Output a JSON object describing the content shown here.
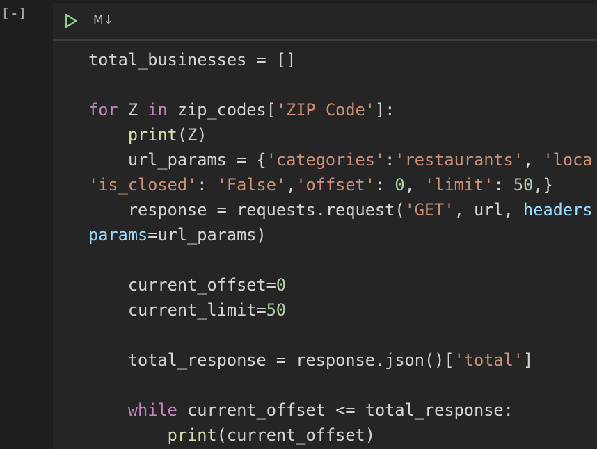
{
  "cell": {
    "execution_count": "[-]",
    "type_label": "M↓",
    "run_icon": "play-icon",
    "run_icon_color": "#89d185"
  },
  "colors": {
    "background": "#1e1e1e",
    "cell_background": "#252526",
    "plain": "#d4d4d4",
    "keyword": "#c586c0",
    "function": "#dcdcaa",
    "string": "#ce9178",
    "number": "#b5cea8",
    "parameter": "#9cdcfe"
  },
  "code": {
    "lines": [
      [
        {
          "t": "total_businesses = []",
          "c": "plain"
        }
      ],
      [],
      [
        {
          "t": "for",
          "c": "kw"
        },
        {
          "t": " Z ",
          "c": "plain"
        },
        {
          "t": "in",
          "c": "kw"
        },
        {
          "t": " zip_codes[",
          "c": "plain"
        },
        {
          "t": "'ZIP Code'",
          "c": "str"
        },
        {
          "t": "]:",
          "c": "plain"
        }
      ],
      [
        {
          "t": "    ",
          "c": "plain"
        },
        {
          "t": "print",
          "c": "fn"
        },
        {
          "t": "(Z)",
          "c": "plain"
        }
      ],
      [
        {
          "t": "    url_params = {",
          "c": "plain"
        },
        {
          "t": "'categories'",
          "c": "str"
        },
        {
          "t": ":",
          "c": "plain"
        },
        {
          "t": "'restaurants'",
          "c": "str"
        },
        {
          "t": ", ",
          "c": "plain"
        },
        {
          "t": "'loca",
          "c": "str"
        }
      ],
      [
        {
          "t": "'is_closed'",
          "c": "str"
        },
        {
          "t": ": ",
          "c": "plain"
        },
        {
          "t": "'False'",
          "c": "str"
        },
        {
          "t": ",",
          "c": "plain"
        },
        {
          "t": "'offset'",
          "c": "str"
        },
        {
          "t": ": ",
          "c": "plain"
        },
        {
          "t": "0",
          "c": "num"
        },
        {
          "t": ", ",
          "c": "plain"
        },
        {
          "t": "'limit'",
          "c": "str"
        },
        {
          "t": ": ",
          "c": "plain"
        },
        {
          "t": "50",
          "c": "num"
        },
        {
          "t": ",}",
          "c": "plain"
        }
      ],
      [
        {
          "t": "    response = requests.request(",
          "c": "plain"
        },
        {
          "t": "'GET'",
          "c": "str"
        },
        {
          "t": ", url, ",
          "c": "plain"
        },
        {
          "t": "headers",
          "c": "param"
        }
      ],
      [
        {
          "t": "params",
          "c": "param"
        },
        {
          "t": "=url_params)",
          "c": "plain"
        }
      ],
      [],
      [
        {
          "t": "    current_offset=",
          "c": "plain"
        },
        {
          "t": "0",
          "c": "num"
        }
      ],
      [
        {
          "t": "    current_limit=",
          "c": "plain"
        },
        {
          "t": "50",
          "c": "num"
        }
      ],
      [],
      [
        {
          "t": "    total_response = response.json()[",
          "c": "plain"
        },
        {
          "t": "'total'",
          "c": "str"
        },
        {
          "t": "]",
          "c": "plain"
        }
      ],
      [],
      [
        {
          "t": "    ",
          "c": "plain"
        },
        {
          "t": "while",
          "c": "kw"
        },
        {
          "t": " current_offset <= total_response:",
          "c": "plain"
        }
      ],
      [
        {
          "t": "        ",
          "c": "plain"
        },
        {
          "t": "print",
          "c": "fn"
        },
        {
          "t": "(current_offset)",
          "c": "plain"
        }
      ]
    ]
  }
}
